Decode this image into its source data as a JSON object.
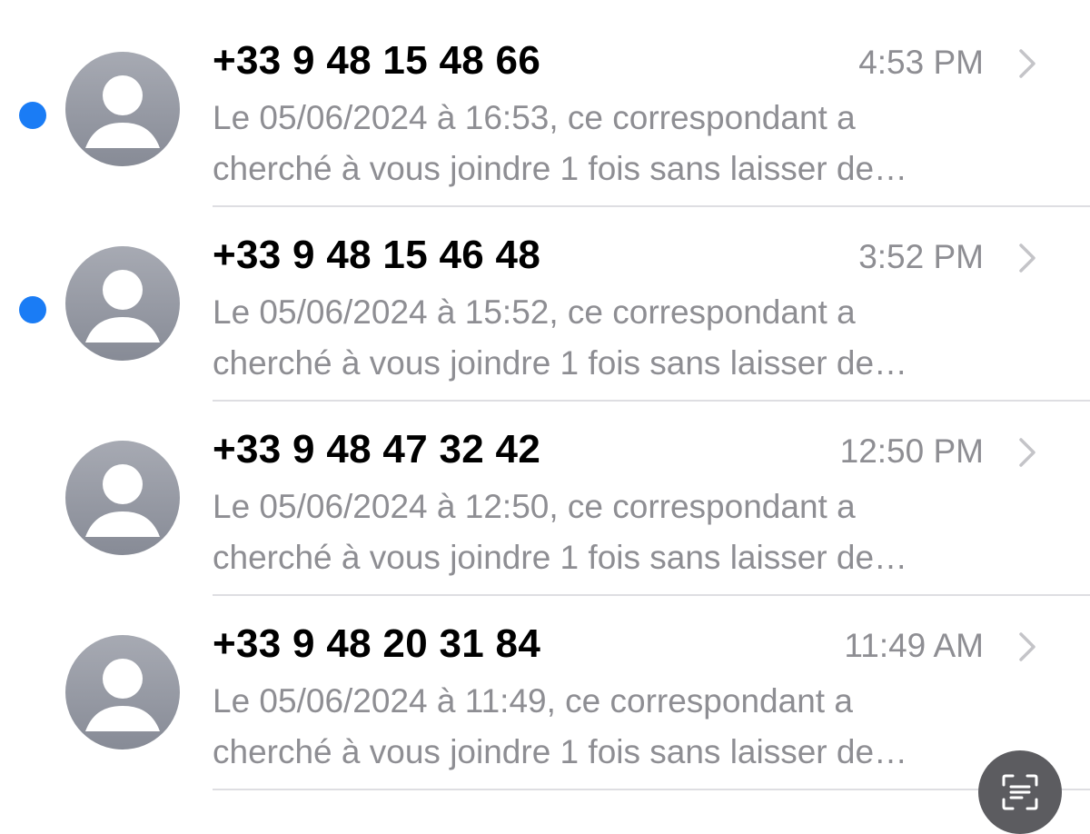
{
  "conversations": [
    {
      "sender": "+33 9 48 15 48 66",
      "time": "4:53 PM",
      "unread": true,
      "preview_line1": "Le 05/06/2024 à 16:53, ce correspondant a",
      "preview_line2": "cherché à vous joindre 1 fois sans laisser de…"
    },
    {
      "sender": "+33 9 48 15 46 48",
      "time": "3:52 PM",
      "unread": true,
      "preview_line1": "Le 05/06/2024 à 15:52, ce correspondant a",
      "preview_line2": "cherché à vous joindre 1 fois sans laisser de…"
    },
    {
      "sender": "+33 9 48 47 32 42",
      "time": "12:50 PM",
      "unread": false,
      "preview_line1": "Le 05/06/2024 à 12:50, ce correspondant a",
      "preview_line2": "cherché à vous joindre 1 fois sans laisser de…"
    },
    {
      "sender": "+33 9 48 20 31 84",
      "time": "11:49 AM",
      "unread": false,
      "preview_line1": "Le 05/06/2024 à 11:49, ce correspondant a",
      "preview_line2": "cherché à vous joindre 1 fois sans laisser de…"
    }
  ],
  "icons": {
    "avatar": "person-placeholder-icon",
    "chevron": "chevron-right-icon",
    "unread": "unread-dot-icon",
    "scan": "text-scan-icon"
  },
  "colors": {
    "unread_dot": "#1a7cf5",
    "secondary_text": "#8e8e93",
    "avatar_gray": "#9a9da6"
  }
}
